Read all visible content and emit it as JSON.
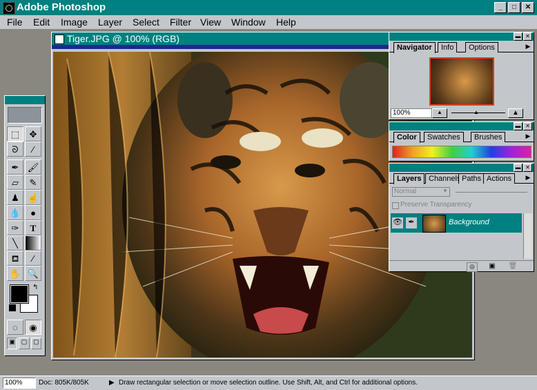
{
  "app": {
    "title": "Adobe Photoshop"
  },
  "window_controls": {
    "minimize": "_",
    "maximize": "□",
    "close": "✕"
  },
  "menu": [
    "File",
    "Edit",
    "Image",
    "Layer",
    "Select",
    "Filter",
    "View",
    "Window",
    "Help"
  ],
  "document": {
    "title": "Tiger.JPG @ 100%  (RGB)"
  },
  "navigator": {
    "tabs": [
      "Navigator",
      "Info",
      "Options"
    ],
    "zoom": "100%"
  },
  "color_palette": {
    "tabs": [
      "Color",
      "Swatches",
      "Brushes"
    ]
  },
  "layers_palette": {
    "tabs": [
      "Layers",
      "Channels",
      "Paths",
      "Actions"
    ],
    "blend_mode": "Normal",
    "preserve_transparency": "Preserve Transparency",
    "layer_name": "Background"
  },
  "toolbox": {
    "tools": [
      "marquee-icon",
      "move-icon",
      "lasso-icon",
      "magic-wand-icon",
      "airbrush-icon",
      "paintbrush-icon",
      "eraser-icon",
      "pencil-icon",
      "rubber-stamp-icon",
      "smudge-icon",
      "blur-icon",
      "burn-icon",
      "pen-icon",
      "type-icon",
      "line-icon",
      "gradient-icon",
      "paint-bucket-icon",
      "eyedropper-icon",
      "hand-icon",
      "zoom-icon"
    ],
    "foreground_color": "#000000",
    "background_color": "#ffffff"
  },
  "status": {
    "zoom": "100%",
    "doc_size": "Doc: 805K/805K",
    "message": "Draw rectangular selection or move selection outline.  Use Shift, Alt, and Ctrl for additional options."
  },
  "colors": {
    "titlebar": "#008080",
    "chrome": "#c3c7cb",
    "workspace": "#8a877f"
  }
}
